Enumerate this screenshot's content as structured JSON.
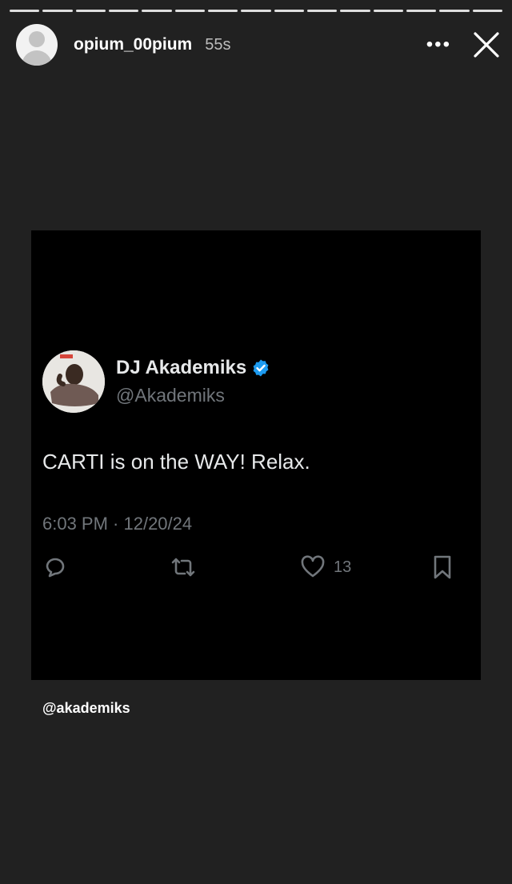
{
  "story": {
    "username": "opium_00pium",
    "time": "55s",
    "more_label": "•••",
    "segments": 15
  },
  "tweet": {
    "name": "DJ Akademiks",
    "handle": "@Akademiks",
    "text": "CARTI is on the WAY! Relax.",
    "meta": "6:03 PM · 12/20/24",
    "like_count": "13",
    "verified_color": "#1d9bf0"
  },
  "mention": "@akademiks",
  "icons": [
    "profile-placeholder-icon",
    "more-icon",
    "close-icon",
    "verified-badge-icon",
    "reply-icon",
    "retweet-icon",
    "like-icon",
    "bookmark-icon"
  ]
}
